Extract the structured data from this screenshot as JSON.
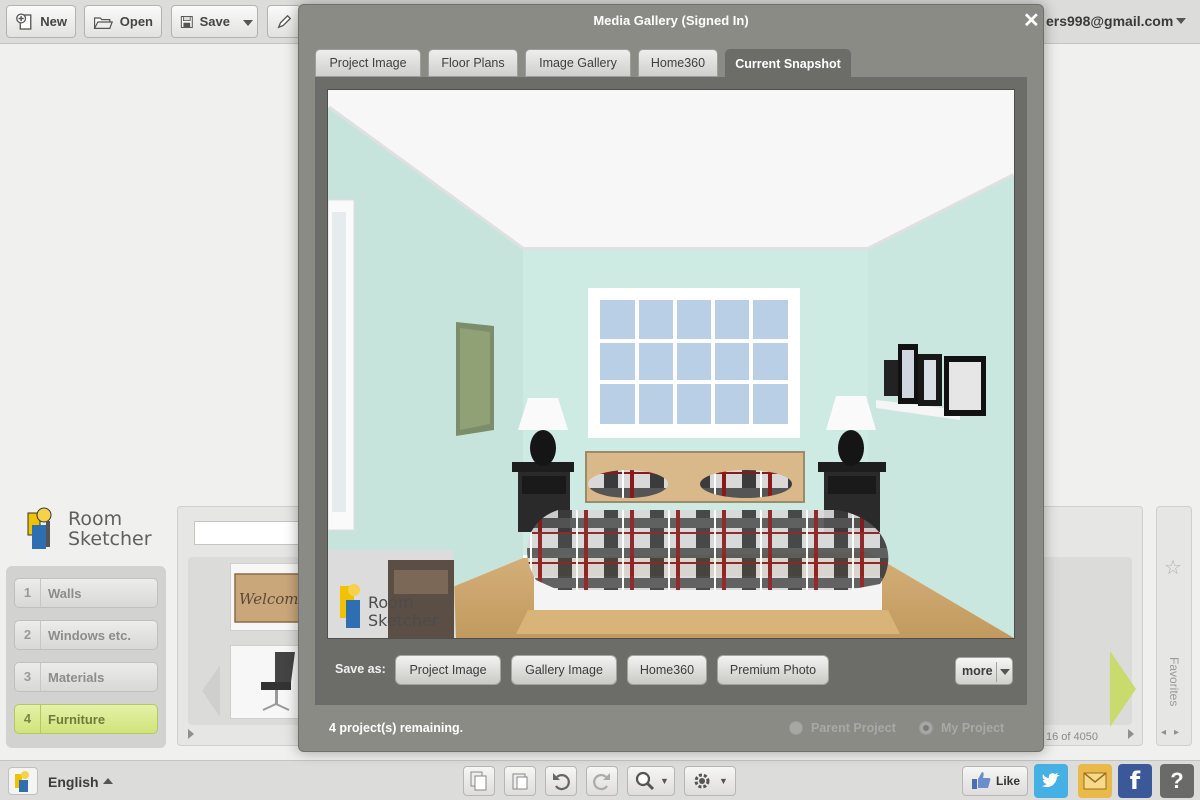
{
  "toolbar": {
    "new_label": "New",
    "open_label": "Open",
    "save_label": "Save",
    "account_email": "ers998@gmail.com"
  },
  "brand": {
    "line1": "Room",
    "line2": "Sketcher"
  },
  "steps": [
    {
      "num": "1",
      "label": "Walls",
      "active": false
    },
    {
      "num": "2",
      "label": "Windows etc.",
      "active": false
    },
    {
      "num": "3",
      "label": "Materials",
      "active": false
    },
    {
      "num": "4",
      "label": "Furniture",
      "active": true
    }
  ],
  "catalog": {
    "paging": "16 of 4050",
    "favorites_label": "Favorites",
    "doormat_text": "Welcome"
  },
  "modal": {
    "title": "Media Gallery (Signed In)",
    "close": "✕",
    "tabs": [
      {
        "label": "Project Image",
        "active": false
      },
      {
        "label": "Floor Plans",
        "active": false
      },
      {
        "label": "Image Gallery",
        "active": false
      },
      {
        "label": "Home360",
        "active": false
      },
      {
        "label": "Current Snapshot",
        "active": true
      }
    ],
    "watermark": {
      "line1": "Room",
      "line2": "Sketcher"
    },
    "save_as_label": "Save as:",
    "save_buttons": [
      "Project Image",
      "Gallery Image",
      "Home360",
      "Premium Photo"
    ],
    "more_label": "more",
    "remaining_text": "4 project(s) remaining.",
    "radio_parent": "Parent Project",
    "radio_mine": "My Project",
    "radio_selected": "My Project"
  },
  "bottombar": {
    "language": "English",
    "like_label": "Like"
  },
  "colors": {
    "wall": "#cbe7e0",
    "floor": "#c9a570",
    "accent_green": "#cfe47a",
    "modal_frame": "#8b8b86",
    "facebook": "#3b5998",
    "twitter": "#45b0e3"
  },
  "icons": {
    "new": "new-file-icon",
    "open": "folder-icon",
    "save": "disk-icon",
    "edit": "pencil-icon",
    "undo": "undo-icon",
    "redo": "redo-icon",
    "zoom": "magnifier-icon",
    "settings": "gear-icon",
    "like": "thumbs-up-icon",
    "twitter": "twitter-icon",
    "mail": "envelope-icon",
    "facebook": "facebook-icon",
    "help": "question-icon",
    "favorites": "star-icon"
  }
}
